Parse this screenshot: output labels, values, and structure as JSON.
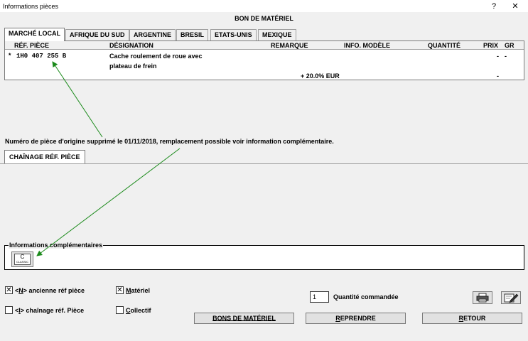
{
  "window": {
    "title": "Informations pièces",
    "help_label": "?",
    "close_label": "✕"
  },
  "page_title": "BON DE MATÉRIEL",
  "tabs": [
    {
      "label": "MARCHÉ LOCAL",
      "active": true
    },
    {
      "label": "AFRIQUE DU SUD"
    },
    {
      "label": "ARGENTINE"
    },
    {
      "label": "BRESIL"
    },
    {
      "label": "ETATS-UNIS"
    },
    {
      "label": "MEXIQUE"
    }
  ],
  "table": {
    "headers": {
      "ref": "RÉF. PIÈCE",
      "designation": "DÉSIGNATION",
      "remarque": "REMARQUE",
      "info_modele": "INFO. MODÈLE",
      "quantite": "QUANTITÉ",
      "prix": "PRIX",
      "gr": "GR"
    },
    "row": {
      "marker": "*",
      "ref": "1H0 407 255 B",
      "designation_line1": "Cache roulement de roue avec",
      "designation_line2": "plateau de frein",
      "prix": "-",
      "gr": "-",
      "tax_note": "+ 20.0% EUR",
      "tax_value": "-"
    }
  },
  "message": "Numéro de pièce d'origine supprimé le 01/11/2018, remplacement possible voir information complémentaire.",
  "subtab_label": "CHAÎNAGE RÉF. PIÈCE",
  "info_group": {
    "legend": "Informations complémentaires",
    "button_letter": "C",
    "button_word": "CLASSIC"
  },
  "options": {
    "ancienne": {
      "prefix": "<",
      "key": "N",
      "suffix": "> ancienne réf pièce",
      "checked": true
    },
    "materiel": {
      "key": "M",
      "rest": "atériel",
      "checked": true
    },
    "chainage": {
      "prefix": "<",
      "key": "I",
      "suffix": "> chaînage réf. Pièce",
      "checked": false
    },
    "collectif": {
      "key": "C",
      "rest": "ollectif",
      "checked": false
    }
  },
  "quantity": {
    "value": "1",
    "label": "Quantité commandée"
  },
  "buttons": {
    "bons_prefix": "BONS DE MATÉRIEL",
    "reprendre_key": "R",
    "reprendre_rest": "EPRENDRE",
    "retour_key": "R",
    "retour_rest": "ETOUR"
  },
  "colors": {
    "annotation_arrow": "#1a8a1a",
    "window_bg": "#f0f0f0",
    "button_bg": "#e1e1e1"
  },
  "icons": [
    "help-icon",
    "close-icon",
    "print-icon",
    "edit-icon",
    "classic-info-icon"
  ]
}
